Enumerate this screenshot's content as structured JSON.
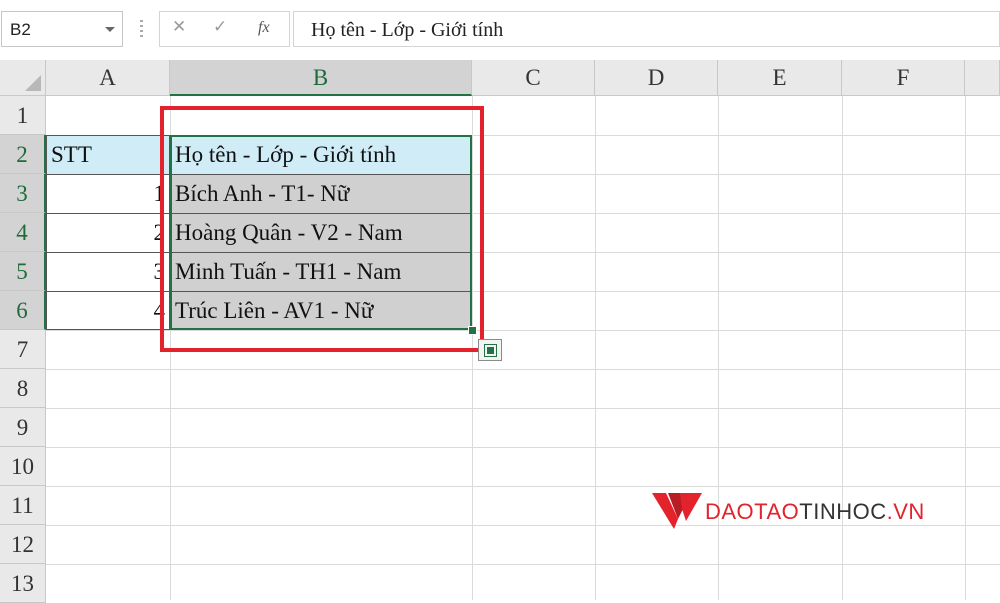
{
  "formula_bar": {
    "name_box": "B2",
    "cancel_icon": "✕",
    "enter_icon": "✓",
    "fx_label": "fx",
    "formula": "Họ tên - Lớp - Giới tính"
  },
  "columns": [
    "A",
    "B",
    "C",
    "D",
    "E",
    "F"
  ],
  "selected_column": "B",
  "rows": [
    "1",
    "2",
    "3",
    "4",
    "5",
    "6",
    "7",
    "8",
    "9",
    "10",
    "11",
    "12",
    "13"
  ],
  "selected_rows": [
    "2",
    "3",
    "4",
    "5",
    "6"
  ],
  "cells": {
    "A2": "STT",
    "B2": "Họ tên - Lớp - Giới tính",
    "A3": "1",
    "B3": "Bích Anh - T1- Nữ",
    "A4": "2",
    "B4": "Hoàng Quân - V2 - Nam",
    "A5": "3",
    "B5": "Minh Tuấn - TH1 - Nam",
    "A6": "4",
    "B6": "Trúc Liên - AV1 - Nữ"
  },
  "watermark": {
    "part1": "DAOTAO",
    "part2": "TINHOC",
    "part3": ".VN"
  },
  "colors": {
    "accent_green": "#217346",
    "header_fill": "#d0ecf7",
    "selection_fill": "#d0d0d0",
    "highlight_red": "#e3222c"
  }
}
